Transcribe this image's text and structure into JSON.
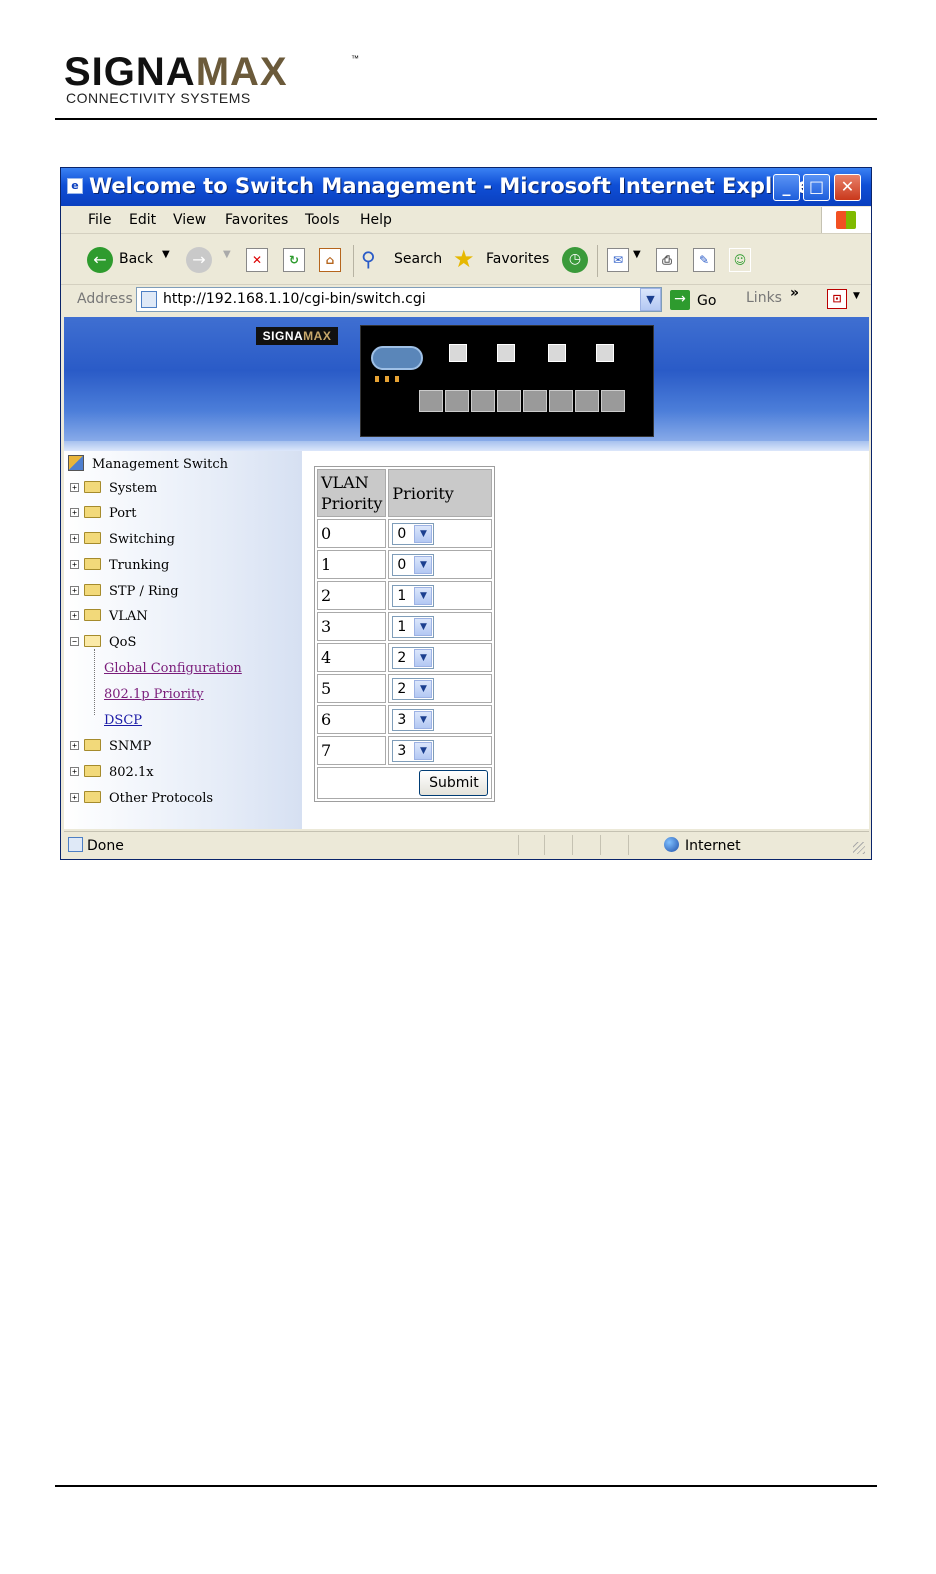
{
  "document": {
    "logo_main": "SIGNA",
    "logo_accent": "MAX",
    "logo_tm": "™",
    "logo_subtitle": "CONNECTIVITY SYSTEMS"
  },
  "window": {
    "title": "Welcome to Switch Management - Microsoft Internet Explorer"
  },
  "menu": [
    "File",
    "Edit",
    "View",
    "Favorites",
    "Tools",
    "Help"
  ],
  "toolbar": {
    "back": "Back",
    "search": "Search",
    "favorites": "Favorites"
  },
  "address": {
    "label": "Address",
    "url": "http://192.168.1.10/cgi-bin/switch.cgi",
    "go": "Go",
    "links": "Links",
    "links_more": "»"
  },
  "banner": {
    "logo_main": "SIGNA",
    "logo_accent": "MAX"
  },
  "tree": {
    "root": "Management Switch",
    "items": [
      "System",
      "Port",
      "Switching",
      "Trunking",
      "STP / Ring",
      "VLAN",
      "QoS"
    ],
    "qos_children": [
      "Global Configuration",
      "802.1p Priority",
      "DSCP"
    ],
    "items_after": [
      "SNMP",
      "802.1x",
      "Other Protocols"
    ]
  },
  "qos_table": {
    "header_vlan_line1": "VLAN",
    "header_vlan_line2": "Priority",
    "header_priority": "Priority",
    "rows": [
      {
        "vlan": "0",
        "priority": "0"
      },
      {
        "vlan": "1",
        "priority": "0"
      },
      {
        "vlan": "2",
        "priority": "1"
      },
      {
        "vlan": "3",
        "priority": "1"
      },
      {
        "vlan": "4",
        "priority": "2"
      },
      {
        "vlan": "5",
        "priority": "2"
      },
      {
        "vlan": "6",
        "priority": "3"
      },
      {
        "vlan": "7",
        "priority": "3"
      }
    ],
    "submit": "Submit"
  },
  "status": {
    "left": "Done",
    "zone": "Internet"
  }
}
